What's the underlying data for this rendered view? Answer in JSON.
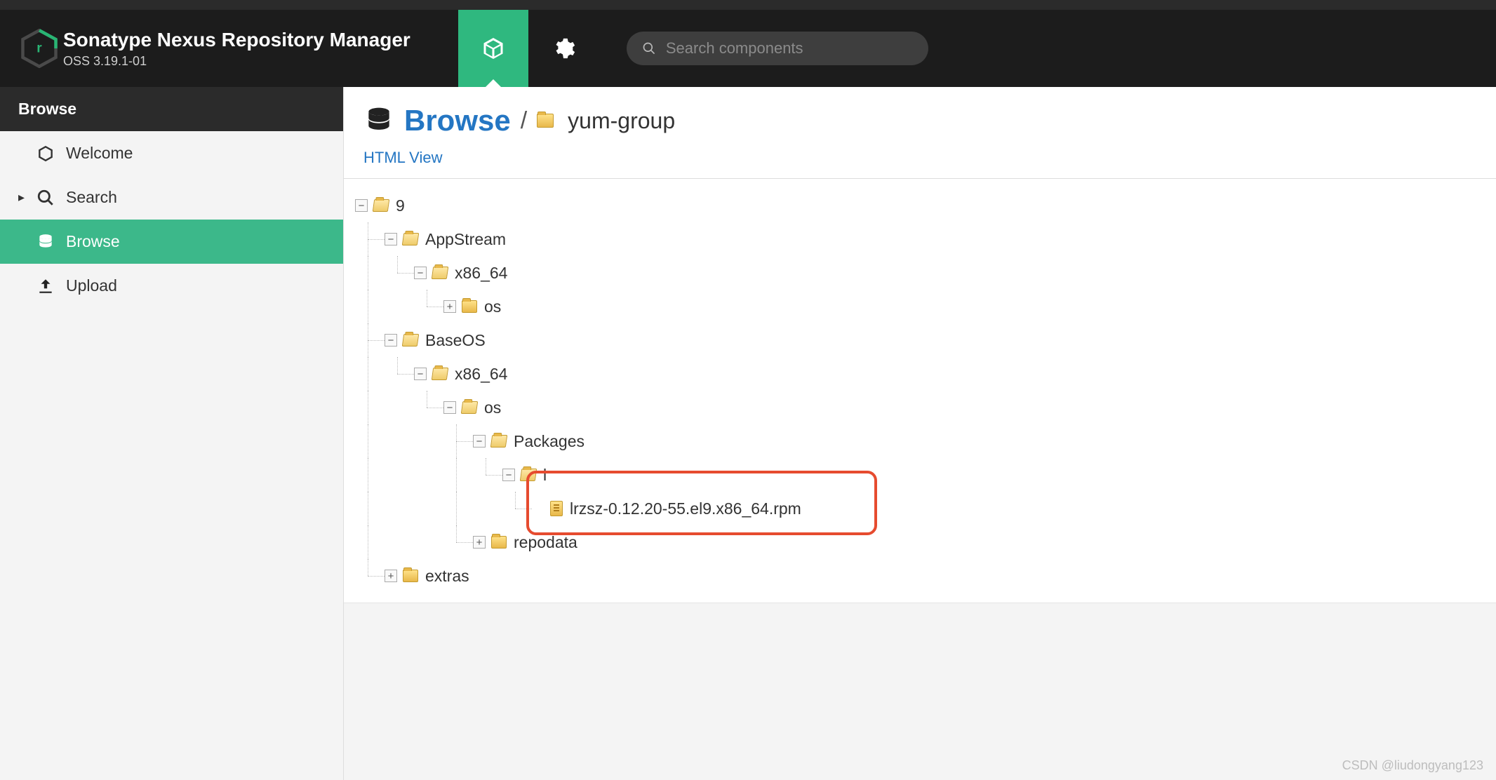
{
  "header": {
    "title": "Sonatype Nexus Repository Manager",
    "version": "OSS 3.19.1-01",
    "search_placeholder": "Search components"
  },
  "sidebar": {
    "header": "Browse",
    "items": [
      {
        "label": "Welcome",
        "icon": "hexagon-icon",
        "active": false,
        "expandable": false
      },
      {
        "label": "Search",
        "icon": "search-icon",
        "active": false,
        "expandable": true
      },
      {
        "label": "Browse",
        "icon": "database-icon",
        "active": true,
        "expandable": false
      },
      {
        "label": "Upload",
        "icon": "upload-icon",
        "active": false,
        "expandable": false
      }
    ]
  },
  "breadcrumb": {
    "title": "Browse",
    "repo": "yum-group",
    "separator": "/"
  },
  "subtool": {
    "html_view": "HTML View"
  },
  "tree": {
    "nodes": [
      {
        "level": 0,
        "toggle": "minus",
        "icon": "folder-open",
        "label": "9"
      },
      {
        "level": 1,
        "toggle": "minus",
        "icon": "folder-open",
        "label": "AppStream"
      },
      {
        "level": 2,
        "toggle": "minus",
        "icon": "folder-open",
        "label": "x86_64"
      },
      {
        "level": 3,
        "toggle": "plus",
        "icon": "folder-closed",
        "label": "os"
      },
      {
        "level": 1,
        "toggle": "minus",
        "icon": "folder-open",
        "label": "BaseOS"
      },
      {
        "level": 2,
        "toggle": "minus",
        "icon": "folder-open",
        "label": "x86_64"
      },
      {
        "level": 3,
        "toggle": "minus",
        "icon": "folder-open",
        "label": "os"
      },
      {
        "level": 4,
        "toggle": "minus",
        "icon": "folder-open",
        "label": "Packages"
      },
      {
        "level": 5,
        "toggle": "minus",
        "icon": "folder-open",
        "label": "l"
      },
      {
        "level": 6,
        "toggle": "none",
        "icon": "file",
        "label": "lrzsz-0.12.20-55.el9.x86_64.rpm",
        "highlighted": true
      },
      {
        "level": 4,
        "toggle": "plus",
        "icon": "folder-closed",
        "label": "repodata"
      },
      {
        "level": 1,
        "toggle": "plus",
        "icon": "folder-closed",
        "label": "extras"
      }
    ]
  },
  "colors": {
    "accent_green": "#2fb87f",
    "link_blue": "#2476c3",
    "highlight_red": "#e64b2f"
  },
  "watermark": "CSDN @liudongyang123"
}
